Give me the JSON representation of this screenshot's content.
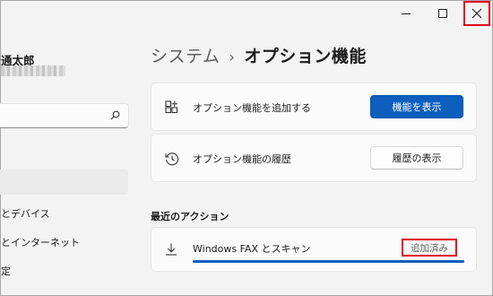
{
  "window": {
    "controls": {
      "minimize_icon": "minimize-icon",
      "maximize_icon": "maximize-icon",
      "close_icon": "close-icon"
    }
  },
  "sidebar": {
    "user_name": "通太郎",
    "search_icon": "search-icon",
    "items": [
      {
        "label": "とデバイス"
      },
      {
        "label": "とインターネット"
      },
      {
        "label": "定"
      }
    ]
  },
  "main": {
    "breadcrumb": {
      "parent": "システム",
      "separator": "›",
      "current": "オプション機能"
    },
    "cards": [
      {
        "icon": "add-features-icon",
        "label": "オプション機能を追加する",
        "button": "機能を表示"
      },
      {
        "icon": "history-icon",
        "label": "オプション機能の履歴",
        "button": "履歴の表示"
      }
    ],
    "recent": {
      "title": "最近のアクション",
      "item": {
        "icon": "download-icon",
        "label": "Windows FAX とスキャン",
        "status": "追加済み",
        "progress": 1.0
      }
    }
  },
  "colors": {
    "accent": "#0e5ebd",
    "highlight": "#e0001a",
    "background": "#f3f3f3",
    "card": "#fbfbfb"
  }
}
